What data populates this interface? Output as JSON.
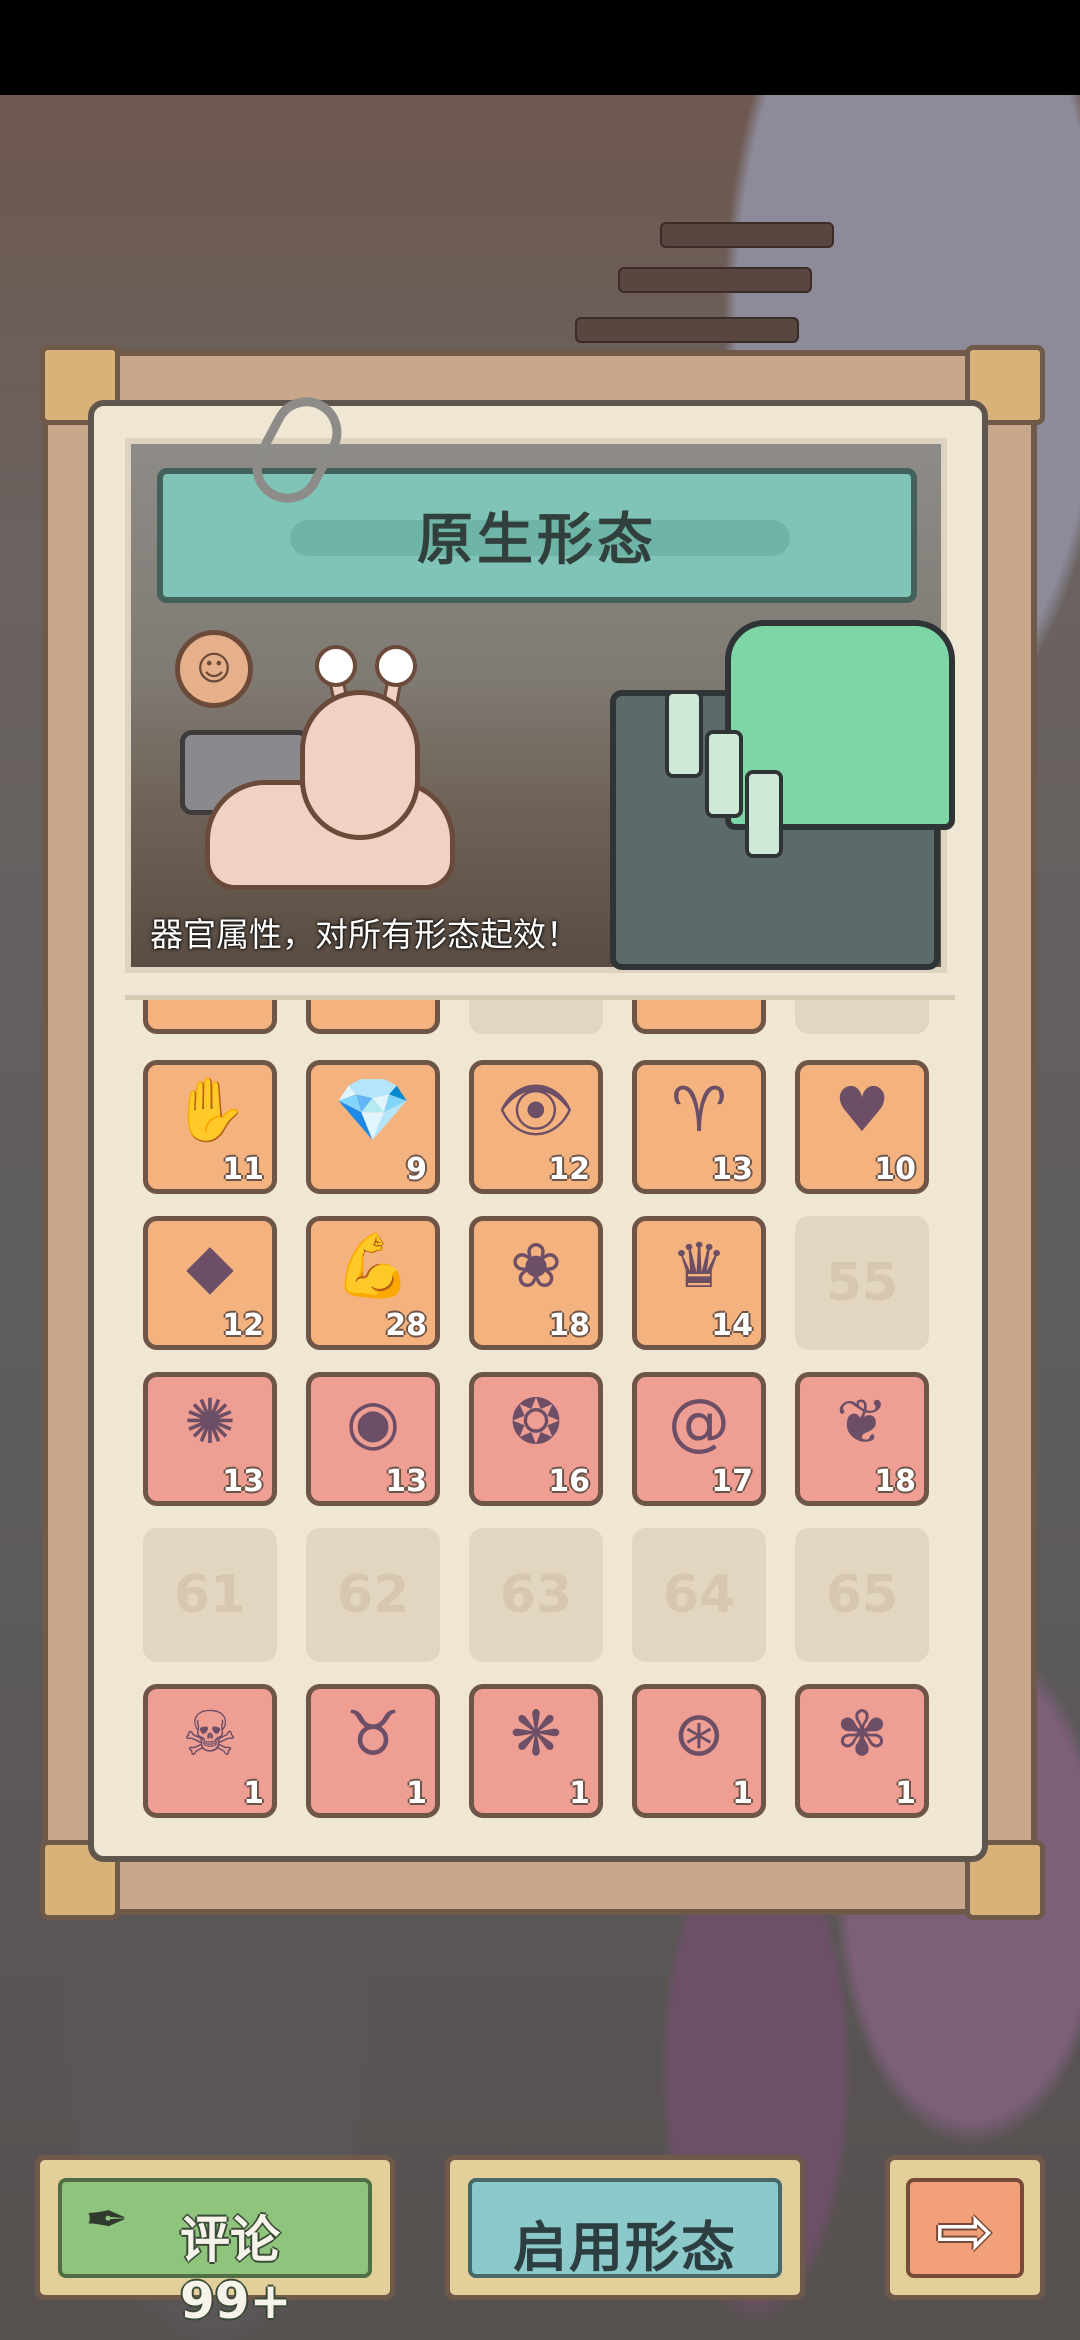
{
  "header": {
    "title": "原生形态"
  },
  "banner": {
    "caption": "器官属性，对所有形态起效！"
  },
  "organs": {
    "row1": [
      {
        "icon": "crystal-claw-icon",
        "glyph": "✋",
        "count": "11",
        "color": "orange"
      },
      {
        "icon": "crystal-arm-icon",
        "glyph": "💎",
        "count": "9",
        "color": "orange"
      },
      {
        "icon": "eye-disc-icon",
        "glyph": "👁",
        "count": "12",
        "color": "orange"
      },
      {
        "icon": "horns-icon",
        "glyph": "♈",
        "count": "13",
        "color": "orange"
      },
      {
        "icon": "heart-organ-icon",
        "glyph": "♥",
        "count": "10",
        "color": "orange"
      }
    ],
    "row2": [
      {
        "icon": "crystal-shard-icon",
        "glyph": "◆",
        "count": "12",
        "color": "orange"
      },
      {
        "icon": "muscle-arm-icon",
        "glyph": "💪",
        "count": "28",
        "color": "orange"
      },
      {
        "icon": "brain-icon",
        "glyph": "❀",
        "count": "18",
        "color": "orange"
      },
      {
        "icon": "spiked-crown-icon",
        "glyph": "♛",
        "count": "14",
        "color": "orange"
      },
      {
        "empty": "55"
      }
    ],
    "row3": [
      {
        "icon": "spine-eye-icon",
        "glyph": "✺",
        "count": "13",
        "color": "pink"
      },
      {
        "icon": "eyeball-blob-icon",
        "glyph": "◉",
        "count": "13",
        "color": "pink"
      },
      {
        "icon": "flesh-eye-icon",
        "glyph": "❂",
        "count": "16",
        "color": "pink"
      },
      {
        "icon": "snail-shell-icon",
        "glyph": "@",
        "count": "17",
        "color": "pink"
      },
      {
        "icon": "flesh-lump-icon",
        "glyph": "❦",
        "count": "18",
        "color": "pink"
      }
    ],
    "row4": [
      {
        "empty": "61"
      },
      {
        "empty": "62"
      },
      {
        "empty": "63"
      },
      {
        "empty": "64"
      },
      {
        "empty": "65"
      }
    ],
    "row5": [
      {
        "icon": "fanged-maw-icon",
        "glyph": "☠",
        "count": "1",
        "color": "pink"
      },
      {
        "icon": "demon-mask-icon",
        "glyph": "♉",
        "count": "1",
        "color": "pink"
      },
      {
        "icon": "winged-brain-icon",
        "glyph": "❋",
        "count": "1",
        "color": "pink"
      },
      {
        "icon": "red-eye-orb-icon",
        "glyph": "⊛",
        "count": "1",
        "color": "pink"
      },
      {
        "icon": "tentacle-eye-icon",
        "glyph": "✾",
        "count": "1",
        "color": "pink"
      }
    ]
  },
  "buttons": {
    "comment_label": "评论 99+",
    "enable_label": "启用形态",
    "next_arrow": "⇨"
  },
  "colors": {
    "slot_orange": "#f4b27f",
    "slot_pink": "#ef9e93",
    "comment_green": "#8fc47c",
    "enable_teal": "#8cc9ca",
    "next_orange": "#f2a07a"
  }
}
